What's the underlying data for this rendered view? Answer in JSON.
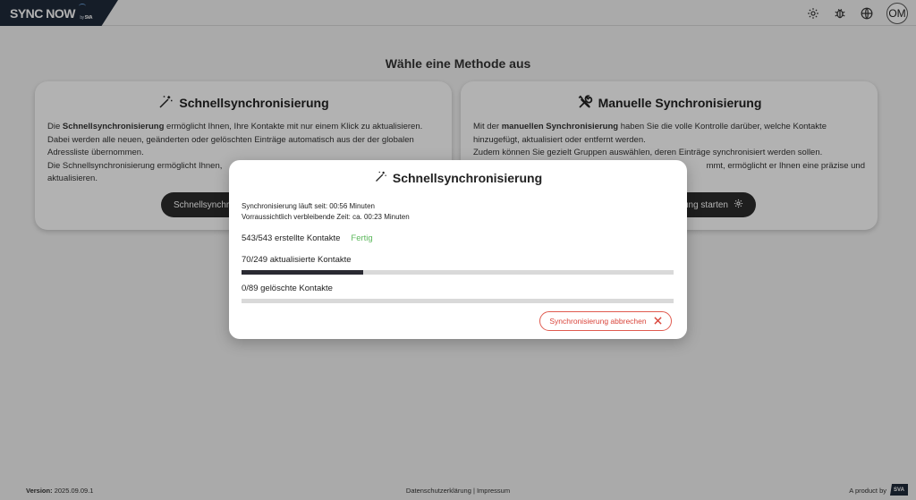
{
  "header": {
    "logo_text": "SYNC NOW",
    "logo_by": "by",
    "logo_brand": "SVA",
    "avatar_initials": "OM"
  },
  "main": {
    "title": "Wähle eine Methode aus",
    "quick_card": {
      "title": "Schnellsynchronisierung",
      "p1_a": "Die ",
      "p1_bold": "Schnellsynchronisierung",
      "p1_b": " ermöglicht Ihnen, Ihre Kontakte mit nur einem Klick zu aktualisieren.",
      "p2": "Dabei werden alle neuen, geänderten oder gelöschten Einträge automatisch aus der der globalen Adressliste übernommen.",
      "p3": "Die Schnellsynchronisierung ermöglicht Ihnen,",
      "p4": "aktualisieren.",
      "button_label": "Schnellsynchro"
    },
    "manual_card": {
      "title": "Manuelle Synchronisierung",
      "p1_a": "Mit der ",
      "p1_bold": "manuellen Synchronisierung",
      "p1_b": " haben Sie die volle Kontrolle darüber, welche Kontakte hinzugefügt, aktualisiert oder entfernt werden.",
      "p2": "Zudem können Sie gezielt Gruppen auswählen, deren Einträge synchronisiert werden sollen.",
      "p3": "mmt, ermöglicht er Ihnen eine präzise und",
      "button_label": "ung starten"
    }
  },
  "modal": {
    "title": "Schnellsynchronisierung",
    "running_since": "Synchronisierung läuft seit: 00:56 Minuten",
    "remaining": "Vorraussichtlich verbleibende Zeit: ca. 00:23 Minuten",
    "created": {
      "label": "543/543 erstellte Kontakte",
      "status": "Fertig",
      "progress": 1.0
    },
    "updated": {
      "label": "70/249 aktualisierte Kontakte",
      "progress": 0.281
    },
    "deleted": {
      "label": "0/89 gelöschte Kontakte",
      "progress": 0.0
    },
    "cancel_label": "Synchronisierung abbrechen"
  },
  "footer": {
    "version_label": "Version:",
    "version_value": "2025.09.09.1",
    "links": "Datenschutzerklärung | Impressum",
    "product_by": "A product by",
    "brand": "SVA"
  },
  "colors": {
    "accent_dark": "#2a2a32",
    "done_green": "#5cb85c",
    "cancel_red": "#d9443a"
  },
  "icons": [
    "gear-icon",
    "bug-icon",
    "globe-icon",
    "magic-wand-icon",
    "tools-icon",
    "close-icon"
  ]
}
